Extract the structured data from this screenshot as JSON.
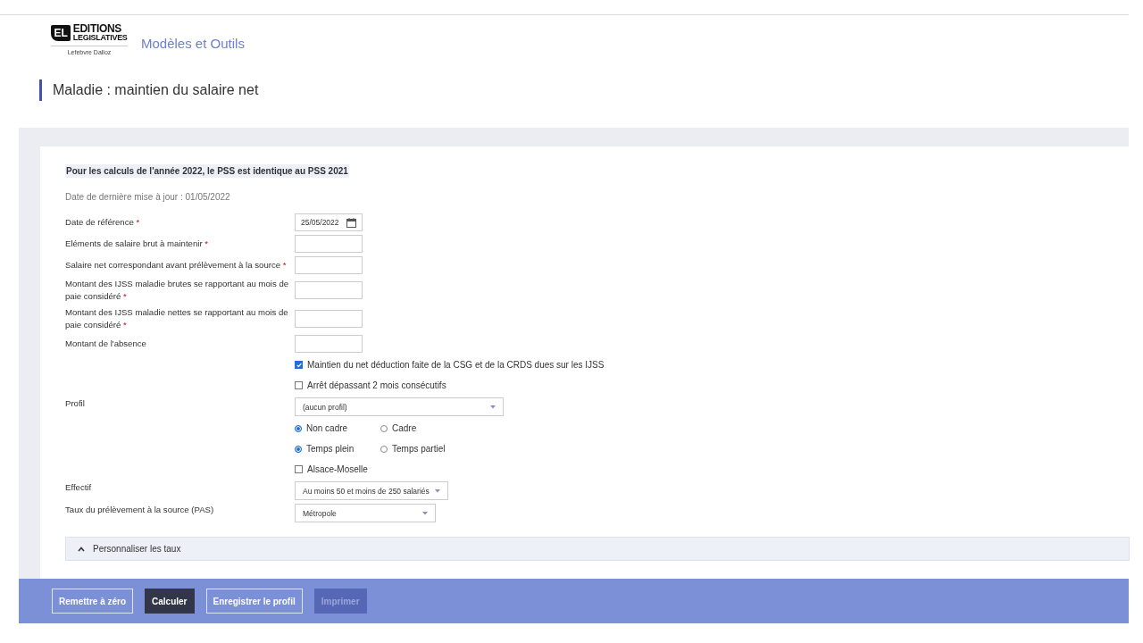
{
  "header": {
    "logo": {
      "mark": "EL",
      "line1": "EDITIONS",
      "line2": "LEGISLATIVES",
      "sub": "Lefebvre Dalloz"
    },
    "app_title": "Modèles et Outils"
  },
  "page_title": "Maladie : maintien du salaire net",
  "notice": "Pour les calculs de l'année 2022, le PSS est identique au PSS 2021",
  "updated": "Date de dernière mise à jour : 01/05/2022",
  "rows": [
    {
      "kind": "date",
      "label": "Date de référence",
      "required_mark": "*",
      "value": "25/05/2022"
    },
    {
      "kind": "input",
      "label": "Eléments de salaire brut à maintenir",
      "required_mark": "*"
    },
    {
      "kind": "input",
      "label": "Salaire net correspondant avant prélèvement à la source",
      "required_mark": "*"
    },
    {
      "kind": "input",
      "label": "Montant des IJSS maladie brutes se rapportant au mois de paie considéré",
      "required_mark": "*"
    },
    {
      "kind": "input",
      "label": "Montant des IJSS maladie nettes se rapportant au mois de paie considéré",
      "required_mark": "*"
    },
    {
      "kind": "input",
      "label": "Montant de l'absence"
    },
    {
      "kind": "checkbox",
      "option": "Maintien du net déduction faite de la CSG et de la CRDS dues sur les IJSS",
      "checked": true
    },
    {
      "kind": "checkbox",
      "option": "Arrêt dépassant 2 mois consécutifs",
      "checked": false
    },
    {
      "kind": "profile-select",
      "label": "Profil",
      "value": "(aucun profil)"
    },
    {
      "kind": "radio",
      "options": [
        {
          "label": "Non cadre",
          "selected": true
        },
        {
          "label": "Cadre",
          "selected": false
        }
      ]
    },
    {
      "kind": "radio",
      "options": [
        {
          "label": "Temps plein",
          "selected": true
        },
        {
          "label": "Temps partiel",
          "selected": false
        }
      ]
    },
    {
      "kind": "checkbox",
      "option": "Alsace-Moselle",
      "checked": false
    },
    {
      "kind": "select",
      "label": "Effectif",
      "value": "Au moins 50 et moins de 250 salariés"
    },
    {
      "kind": "select",
      "label": "Taux du prélèvement à la source (PAS)",
      "value": "Métropole"
    }
  ],
  "accordion": {
    "label": "Personnaliser les taux",
    "expanded": true
  },
  "buttons": [
    {
      "label": "Remettre à zéro",
      "kind": "outline",
      "disabled": false
    },
    {
      "label": "Calculer",
      "kind": "primary",
      "disabled": false
    },
    {
      "label": "Enregistrer le profil",
      "kind": "outline",
      "disabled": false
    },
    {
      "label": "Imprimer",
      "kind": "outline",
      "disabled": true
    }
  ]
}
